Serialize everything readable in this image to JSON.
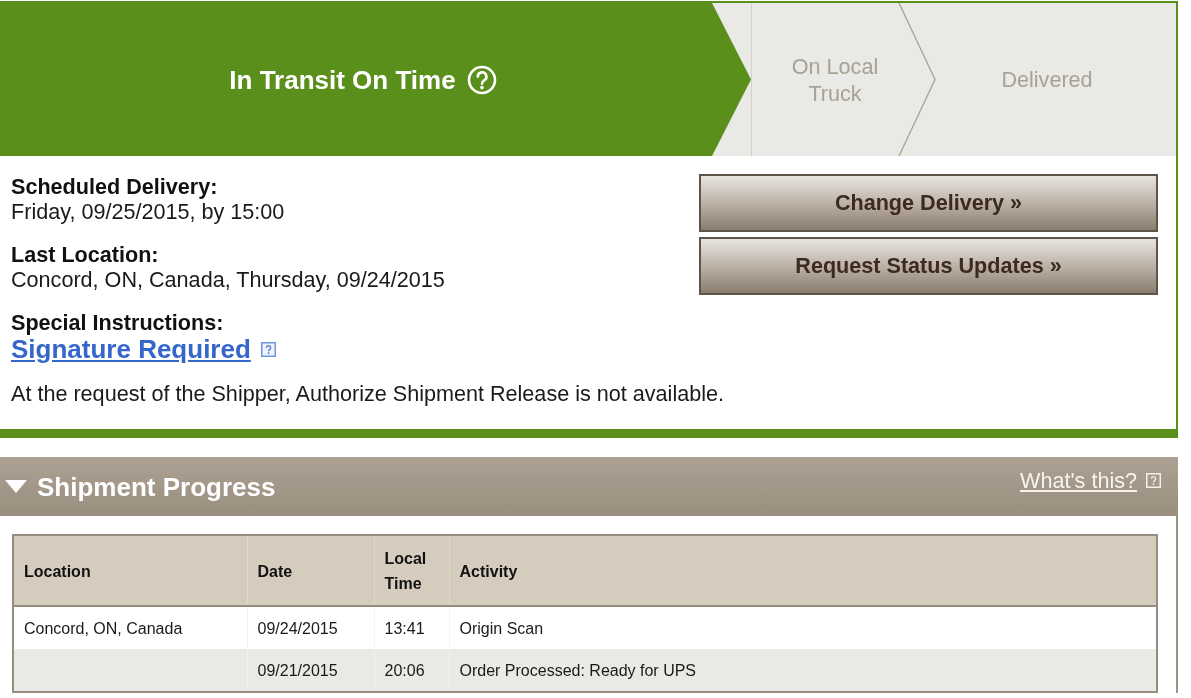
{
  "progress": {
    "steps": [
      {
        "label": "In Transit On Time",
        "selected": true,
        "help": true
      },
      {
        "label": "On Local Truck",
        "selected": false,
        "help": false
      },
      {
        "label": "Delivered",
        "selected": false,
        "help": false
      }
    ]
  },
  "details": [
    {
      "label": "Scheduled Delivery:",
      "value": "Friday, 09/25/2015, by 15:00"
    },
    {
      "label": "Last Location:",
      "value": "Concord, ON, Canada, Thursday, 09/24/2015"
    }
  ],
  "special_instructions": {
    "label": "Special Instructions:",
    "link": "Signature Required"
  },
  "notice": "At the request of the Shipper, Authorize Shipment Release is not available.",
  "actions": [
    "Change Delivery »",
    "Request Status Updates »"
  ],
  "shipment_progress": {
    "title": "Shipment Progress",
    "expanded": true,
    "help_link": "What's this?",
    "table": {
      "columns": [
        "Location",
        "Date",
        "Local Time",
        "Activity"
      ],
      "rows": [
        {
          "location": "Concord, ON, Canada",
          "date": "09/24/2015",
          "local_time": "13:41",
          "activity": "Origin Scan"
        },
        {
          "date": "09/21/2015",
          "local_time": "20:06",
          "activity": "Order Processed: Ready for UPS"
        }
      ]
    }
  }
}
